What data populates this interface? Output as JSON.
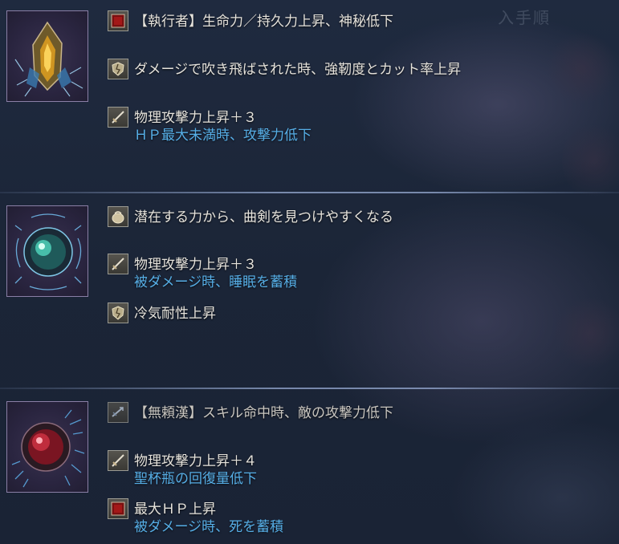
{
  "header": {
    "corner_label": "入手順"
  },
  "relics": [
    {
      "icon": "amber-crystal-relic-icon",
      "effects": [
        {
          "icon": "red-square-icon",
          "text": "【執行者】生命力／持久力上昇、神秘低下",
          "sub": ""
        },
        {
          "icon": "shield-cracked-icon",
          "text": "ダメージで吹き飛ばされた時、強靭度とカット率上昇",
          "sub": ""
        },
        {
          "icon": "sword-icon",
          "text": "物理攻撃力上昇＋３",
          "sub": "ＨＰ最大未満時、攻撃力低下"
        }
      ]
    },
    {
      "icon": "teal-orb-relic-icon",
      "effects": [
        {
          "icon": "pouch-icon",
          "text": "潜在する力から、曲剣を見つけやすくなる",
          "sub": ""
        },
        {
          "icon": "sword-icon",
          "text": "物理攻撃力上昇＋３",
          "sub": "被ダメージ時、睡眠を蓄積"
        },
        {
          "icon": "shield-cracked-icon",
          "text": "冷気耐性上昇",
          "sub": ""
        }
      ]
    },
    {
      "icon": "crimson-orb-relic-icon",
      "effects": [
        {
          "icon": "skill-arrow-icon",
          "text": "【無頼漢】スキル命中時、敵の攻撃力低下",
          "sub": ""
        },
        {
          "icon": "sword-icon",
          "text": "物理攻撃力上昇＋４",
          "sub": "聖杯瓶の回復量低下"
        },
        {
          "icon": "red-square-icon",
          "text": "最大ＨＰ上昇",
          "sub": "被ダメージ時、死を蓄積"
        }
      ]
    }
  ]
}
